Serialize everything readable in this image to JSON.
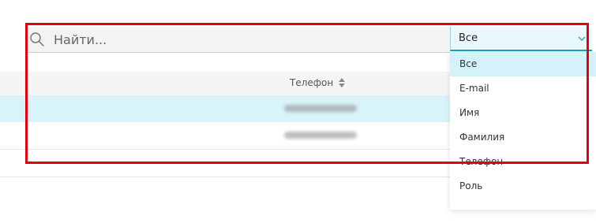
{
  "search": {
    "placeholder": "Найти..."
  },
  "filter": {
    "selected": "Все",
    "options": [
      "Все",
      "E-mail",
      "Имя",
      "Фамилия",
      "Телефон",
      "Роль"
    ]
  },
  "table": {
    "columns": [
      "Телефон"
    ]
  },
  "colors": {
    "accent": "#19a3c6",
    "selected_row": "#d9f3fa",
    "highlight": "#e3000f"
  }
}
